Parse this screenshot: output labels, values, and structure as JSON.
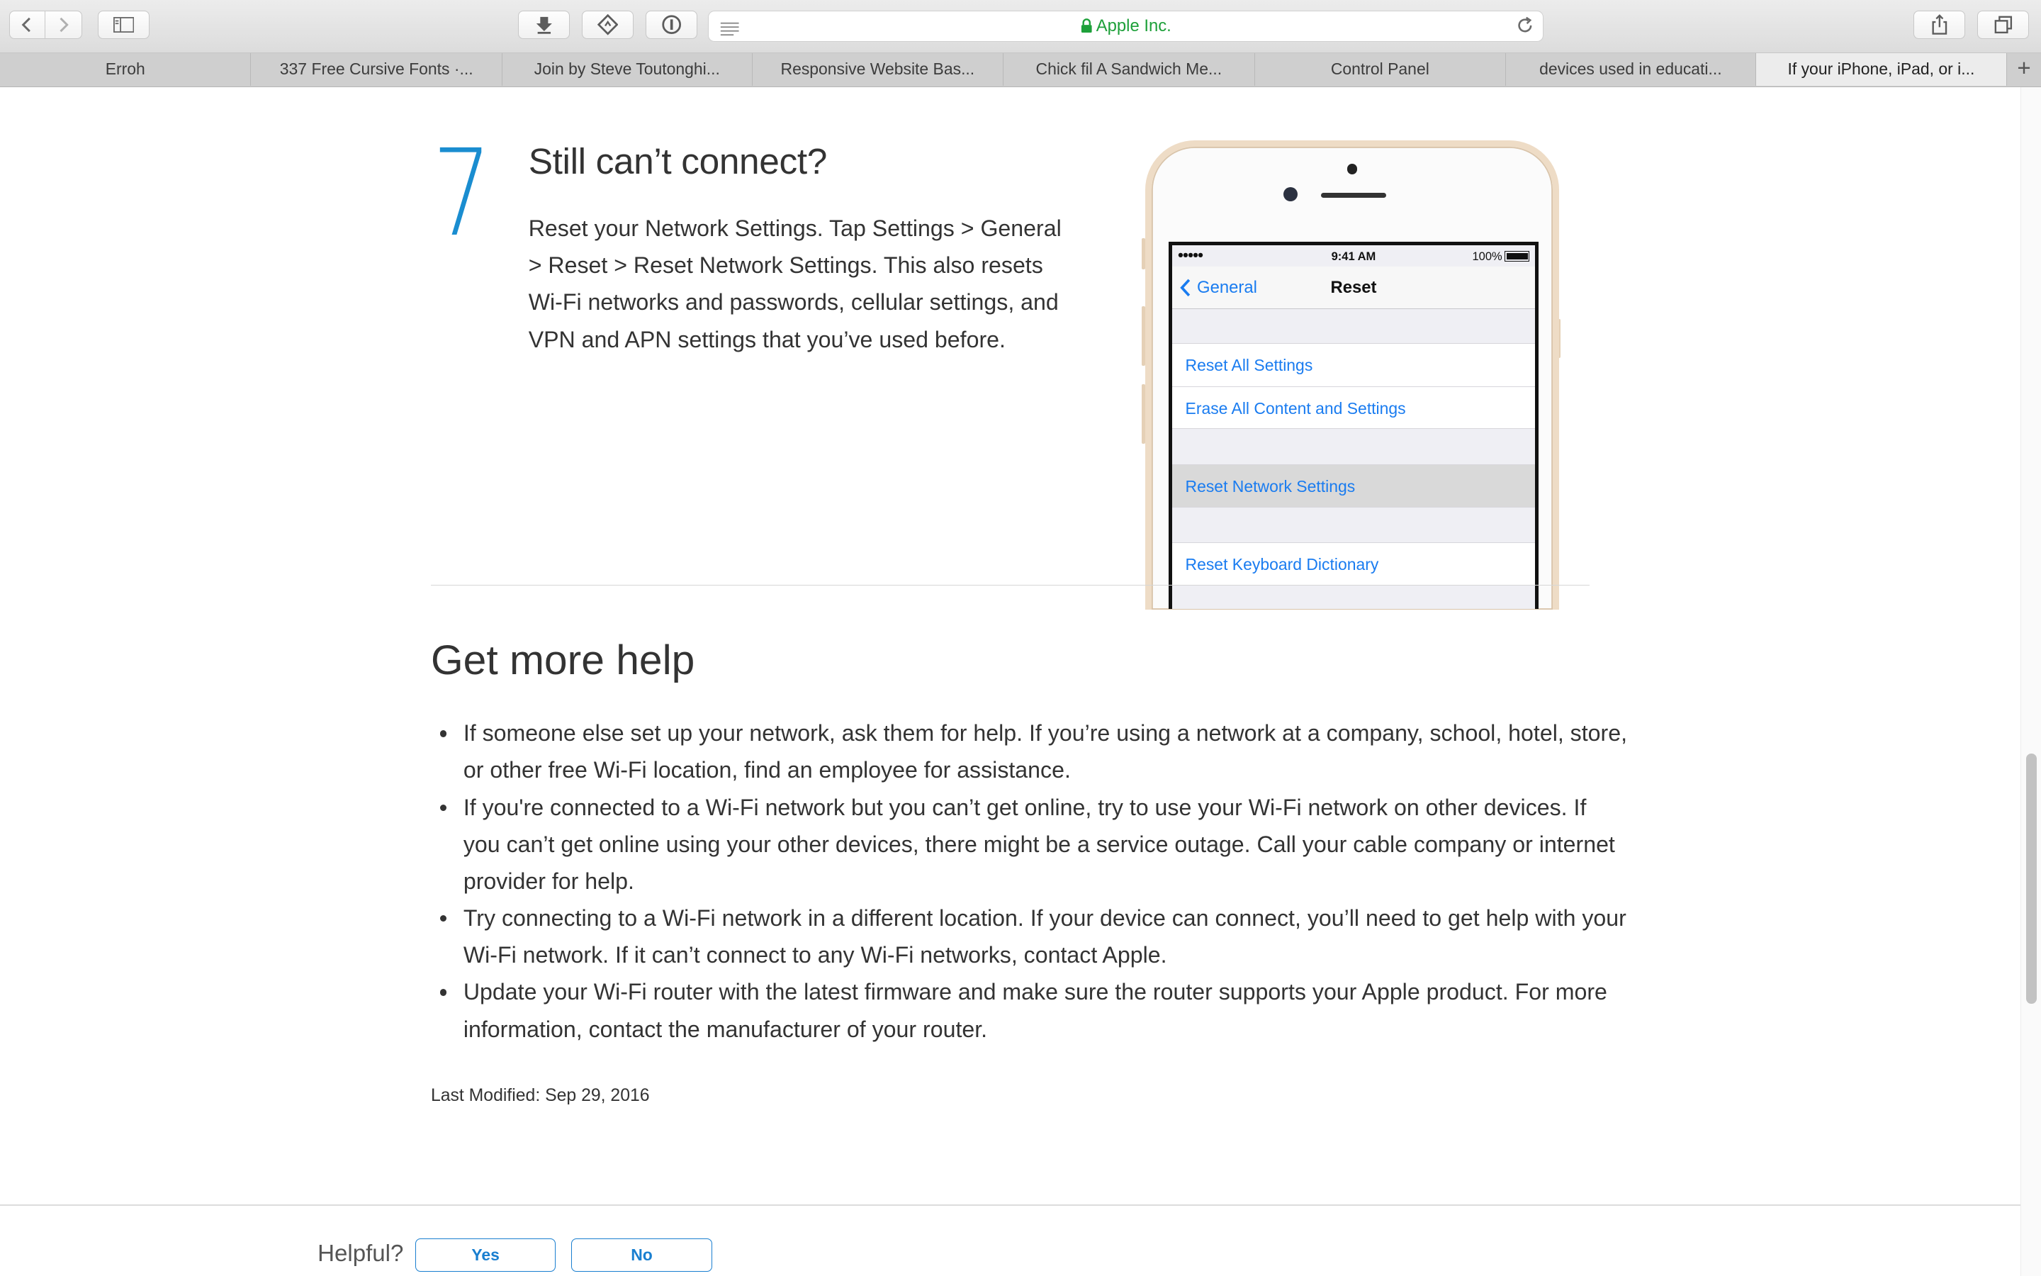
{
  "browser": {
    "address": {
      "site": "Apple Inc.",
      "secure": true
    },
    "icons": {
      "back": "chevron-left-icon",
      "forward": "chevron-right-icon",
      "sidebar": "sidebar-icon",
      "download": "download-icon",
      "extension": "extension-icon",
      "password": "password-icon",
      "reader": "reader-icon",
      "reload": "reload-icon",
      "share": "share-icon",
      "tabs": "tabs-overview-icon"
    },
    "tabs": [
      {
        "label": "Erroh"
      },
      {
        "label": "337 Free Cursive Fonts ·..."
      },
      {
        "label": "Join by Steve Toutonghi..."
      },
      {
        "label": "Responsive Website Bas..."
      },
      {
        "label": "Chick fil A Sandwich Me..."
      },
      {
        "label": "Control Panel"
      },
      {
        "label": "devices used in educati..."
      },
      {
        "label": "If your iPhone, iPad, or i..."
      }
    ],
    "new_tab": "+"
  },
  "step": {
    "number": "7",
    "title": "Still can’t connect?",
    "body": "Reset your Network Settings. Tap Settings > General > Reset > Reset Network Settings. This also resets Wi-Fi networks and passwords, cellular settings, and VPN and APN settings that you’ve used before."
  },
  "phone": {
    "status": {
      "signal": "●●●●●",
      "time": "9:41 AM",
      "battery": "100%"
    },
    "nav": {
      "back": "General",
      "title": "Reset"
    },
    "cells": [
      "Reset All Settings",
      "Erase All Content and Settings",
      "Reset Network Settings",
      "Reset Keyboard Dictionary"
    ],
    "highlighted": "Reset Network Settings"
  },
  "help": {
    "heading": "Get more help",
    "items": [
      "If someone else set up your network, ask them for help. If you’re using a network at a company, school, hotel, store, or other free Wi-Fi location, find an employee for assistance.",
      "If you're connected to a Wi-Fi network but you can’t get online, try to use your Wi-Fi network on other devices. If you can’t get online using your other devices, there might be a service outage. Call your cable company or internet provider for help.",
      "Try connecting to a Wi-Fi network in a different location. If your device can connect, you’ll need to get help with your Wi-Fi network. If it can’t connect to any Wi-Fi networks, contact Apple.",
      "Update your Wi-Fi router with the latest firmware and make sure the router supports your Apple product. For more information, contact the manufacturer of your router."
    ],
    "last_modified": "Last Modified: Sep 29, 2016"
  },
  "feedback": {
    "label": "Helpful?",
    "yes": "Yes",
    "no": "No"
  },
  "colors": {
    "accent": "#1a8dd0",
    "link": "#1a7cf0",
    "secure": "#1ea03a"
  }
}
